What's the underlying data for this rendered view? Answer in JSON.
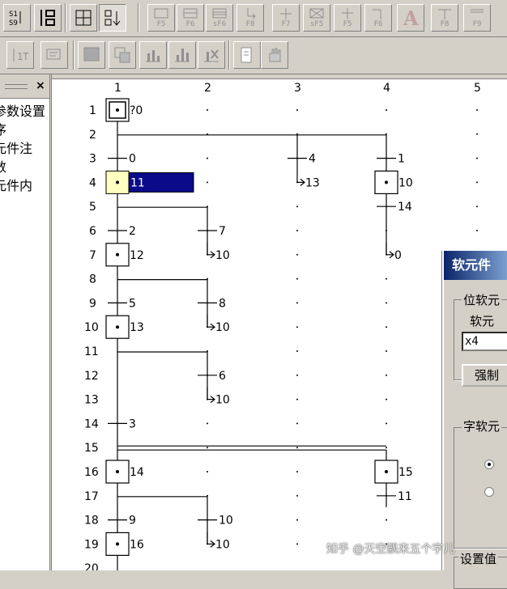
{
  "toolbar1": {
    "buttons": [
      {
        "name": "step-list-button",
        "icon": "s1-s9-icon",
        "key": "S1\nS9"
      },
      {
        "name": "ladder-toggle-button",
        "icon": "ladder-icon",
        "key": ""
      },
      {
        "name": "grid-view-button",
        "icon": "grid-icon",
        "key": ""
      },
      {
        "name": "sort-button",
        "icon": "sort-icon",
        "key": ""
      },
      {
        "name": "f5-button",
        "icon": "step-box-icon",
        "key": "F5"
      },
      {
        "name": "f6-button",
        "icon": "jump-box-icon",
        "key": "F6"
      },
      {
        "name": "sf6-button",
        "icon": "multi-box-icon",
        "key": "sF6"
      },
      {
        "name": "f8-button",
        "icon": "jump-arrow-icon",
        "key": "F8"
      },
      {
        "name": "f7-button",
        "icon": "transition-icon",
        "key": "F7"
      },
      {
        "name": "sf5-button",
        "icon": "cross-box-icon",
        "key": "sF5"
      },
      {
        "name": "f5b-button",
        "icon": "branch-icon",
        "key": "F5"
      },
      {
        "name": "f6b-button",
        "icon": "branch-end-icon",
        "key": "F6"
      },
      {
        "name": "a-button",
        "icon": "letter-a-icon",
        "key": ""
      },
      {
        "name": "f8b-button",
        "icon": "merge-icon",
        "key": "F8"
      },
      {
        "name": "f9-button",
        "icon": "merge-end-icon",
        "key": "F9"
      }
    ]
  },
  "toolbar2": {
    "buttons": [
      {
        "name": "instruction-button",
        "icon": "instruction-icon"
      },
      {
        "name": "comment-button",
        "icon": "comment-icon"
      },
      {
        "name": "monitor-button",
        "icon": "monitor-icon"
      },
      {
        "name": "copy-button",
        "icon": "copy-icon"
      },
      {
        "name": "bar-chart-button",
        "icon": "bar-chart-icon"
      },
      {
        "name": "bar-chart2-button",
        "icon": "bar-chart-up-icon"
      },
      {
        "name": "delete-button",
        "icon": "delete-icon"
      },
      {
        "name": "print-button",
        "icon": "print-icon"
      },
      {
        "name": "hand-button",
        "icon": "hand-icon"
      }
    ]
  },
  "left_panel": {
    "close_label": "×",
    "items": [
      "参数设置",
      "序",
      "元件注",
      "数",
      "元件内"
    ]
  },
  "ladder": {
    "columns": [
      "1",
      "2",
      "3",
      "4",
      "5"
    ],
    "rows": [
      "1",
      "2",
      "3",
      "4",
      "5",
      "6",
      "7",
      "8",
      "9",
      "10",
      "11",
      "12",
      "13",
      "14",
      "15",
      "16",
      "17",
      "18",
      "19",
      "20"
    ],
    "labels": {
      "r1_step": "?0",
      "r3_c1": "0",
      "r3_c3": "4",
      "r3_c4": "1",
      "r4_step": "11",
      "r4_c3": "13",
      "r4_c4": "10",
      "r5_c4": "14",
      "r6_c1": "2",
      "r6_c2": "7",
      "r7_step": "12",
      "r7_c2": "10",
      "r7_c4": "0",
      "r9_c1": "5",
      "r9_c2": "8",
      "r10_step": "13",
      "r10_c2": "10",
      "r12_c2": "6",
      "r13_c2": "10",
      "r14_c1": "3",
      "r16_step": "14",
      "r16_c4": "15",
      "r17_c4": "11",
      "r18_c1": "9",
      "r18_c2": "10",
      "r19_step": "16",
      "r19_c2": "10"
    }
  },
  "dialog": {
    "title": "软元件",
    "bit_group": "位软元",
    "device_label": "软元",
    "device_value": "x4",
    "force_button": "强制",
    "word_group": "字软元",
    "set_value": "设置值"
  },
  "watermark": "知乎 @天空飘来五个字儿",
  "colors": {
    "selection": "#0a0a8a",
    "cursor": "#ffffc0",
    "title_bar": "#0a246a"
  }
}
